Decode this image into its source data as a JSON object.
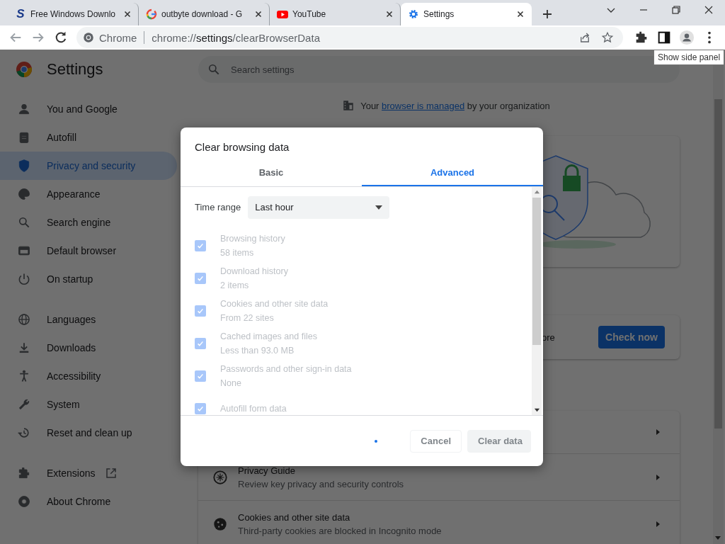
{
  "browser": {
    "tabs": [
      {
        "title": "Free Windows Downlo",
        "favicon_glyph": "S",
        "kind": "letter",
        "selected": false
      },
      {
        "title": "outbyte download - G",
        "kind": "google",
        "selected": false
      },
      {
        "title": "YouTube",
        "kind": "youtube",
        "selected": false
      },
      {
        "title": "Settings",
        "kind": "gear",
        "selected": true
      }
    ],
    "omnibox": {
      "site_label": "Chrome",
      "url_parts": [
        "chrome://",
        "settings",
        "/clearBrowserData"
      ]
    },
    "tooltip": "Show side panel"
  },
  "settings": {
    "title": "Settings",
    "search": {
      "placeholder": "Search settings"
    },
    "sidebar": {
      "sections": [
        {
          "items": [
            {
              "label": "You and Google",
              "selected": false
            },
            {
              "label": "Autofill",
              "selected": false
            },
            {
              "label": "Privacy and security",
              "selected": true
            },
            {
              "label": "Appearance",
              "selected": false
            },
            {
              "label": "Search engine",
              "selected": false
            },
            {
              "label": "Default browser",
              "selected": false
            },
            {
              "label": "On startup",
              "selected": false
            }
          ]
        },
        {
          "items": [
            {
              "label": "Languages",
              "selected": false
            },
            {
              "label": "Downloads",
              "selected": false
            },
            {
              "label": "Accessibility",
              "selected": false
            },
            {
              "label": "System",
              "selected": false
            },
            {
              "label": "Reset and clean up",
              "selected": false
            }
          ]
        },
        {
          "items": [
            {
              "label": "Extensions",
              "selected": false,
              "external": true
            },
            {
              "label": "About Chrome",
              "selected": false,
              "external": false
            }
          ]
        }
      ]
    },
    "managed_notice": {
      "before": "Your ",
      "link": "browser is managed",
      "after": " by your organization"
    },
    "safety_check": {
      "text_fragment": "ore",
      "button": "Check now"
    },
    "privacy_rows": [
      {
        "kind": "covered"
      },
      {
        "kind": "row",
        "title": "Privacy Guide",
        "subtitle": "Review key privacy and security controls"
      },
      {
        "kind": "row",
        "title": "Cookies and other site data",
        "subtitle": "Third-party cookies are blocked in Incognito mode"
      }
    ]
  },
  "dialog": {
    "title": "Clear browsing data",
    "tabs": [
      {
        "label": "Basic",
        "selected": false
      },
      {
        "label": "Advanced",
        "selected": true
      }
    ],
    "time_range": {
      "label": "Time range",
      "value": "Last hour"
    },
    "items": [
      {
        "label": "Browsing history",
        "detail": "58 items",
        "checked": true,
        "disabled": true
      },
      {
        "label": "Download history",
        "detail": "2 items",
        "checked": true,
        "disabled": true
      },
      {
        "label": "Cookies and other site data",
        "detail": "From 22 sites",
        "checked": true,
        "disabled": true
      },
      {
        "label": "Cached images and files",
        "detail": "Less than 93.0 MB",
        "checked": true,
        "disabled": true
      },
      {
        "label": "Passwords and other sign-in data",
        "detail": "None",
        "checked": true,
        "disabled": true
      },
      {
        "label": "Autofill form data",
        "checked": true,
        "disabled": true
      }
    ],
    "busy": true,
    "buttons": [
      {
        "label": "Cancel",
        "kind": "text",
        "disabled": true
      },
      {
        "label": "Clear data",
        "kind": "action",
        "disabled": true
      }
    ]
  }
}
